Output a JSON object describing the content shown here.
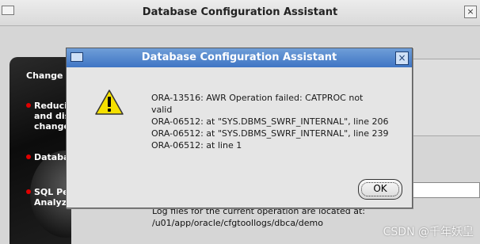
{
  "main_window": {
    "title": "Database Configuration Assistant",
    "close_glyph": "×"
  },
  "side_panel": {
    "items": [
      {
        "label": "Change",
        "bullet": false
      },
      {
        "label": "Reduci\nand dis\nchange",
        "bullet": true
      },
      {
        "label": "Databa",
        "bullet": true
      },
      {
        "label": "SQL Pe\nAnalyz",
        "bullet": true
      }
    ]
  },
  "log": {
    "line1": "Log files for the current operation are located at:",
    "line2": "/u01/app/oracle/cfgtoollogs/dbca/demo"
  },
  "dialog": {
    "title": "Database Configuration Assistant",
    "close_glyph": "×",
    "icon": "warning-icon",
    "message_lines": [
      "ORA-13516: AWR Operation failed: CATPROC not",
      "valid",
      "ORA-06512: at \"SYS.DBMS_SWRF_INTERNAL\", line 206",
      "ORA-06512: at \"SYS.DBMS_SWRF_INTERNAL\", line 239",
      "ORA-06512: at line 1"
    ],
    "ok_label": "OK"
  },
  "watermark": "CSDN @千年妖皇"
}
